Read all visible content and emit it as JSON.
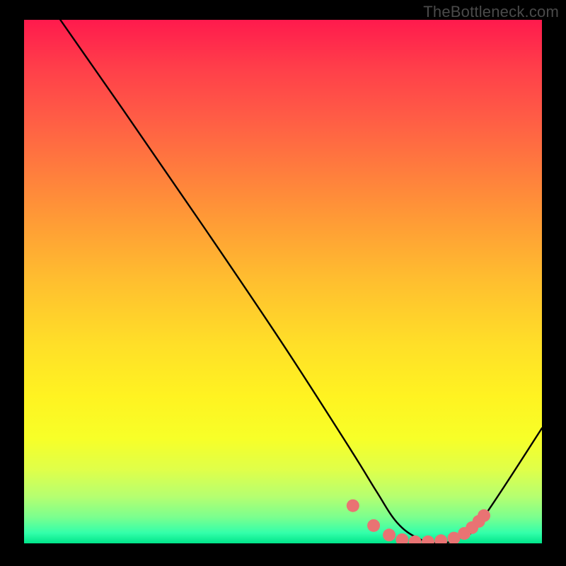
{
  "watermark": "TheBottleneck.com",
  "chart_data": {
    "type": "line",
    "title": "",
    "xlabel": "",
    "ylabel": "",
    "xlim": [
      0,
      100
    ],
    "ylim": [
      0,
      100
    ],
    "grid": false,
    "series": [
      {
        "name": "curve",
        "x": [
          7,
          19,
          35,
          50,
          63,
          68,
          72,
          76,
          80,
          84,
          88,
          100
        ],
        "y": [
          100,
          83,
          60,
          38,
          18,
          10,
          4,
          1,
          0,
          1,
          4,
          22
        ],
        "color": "#000000"
      }
    ],
    "markers": {
      "name": "bottom-dots",
      "x": [
        63.5,
        67.5,
        70.5,
        73.0,
        75.5,
        78.0,
        80.5,
        83.0,
        85.0,
        86.5,
        87.8,
        88.8
      ],
      "y": [
        7.2,
        3.4,
        1.6,
        0.7,
        0.3,
        0.3,
        0.5,
        1.0,
        1.9,
        3.0,
        4.2,
        5.3
      ],
      "color": "#e97373",
      "radius": 9
    },
    "background_gradient": {
      "type": "vertical",
      "stops": [
        {
          "pos": 0.0,
          "color": "#ff1a4d"
        },
        {
          "pos": 0.5,
          "color": "#ffbf2f"
        },
        {
          "pos": 0.8,
          "color": "#f7ff28"
        },
        {
          "pos": 0.95,
          "color": "#7bff8e"
        },
        {
          "pos": 1.0,
          "color": "#00e58a"
        }
      ]
    }
  }
}
